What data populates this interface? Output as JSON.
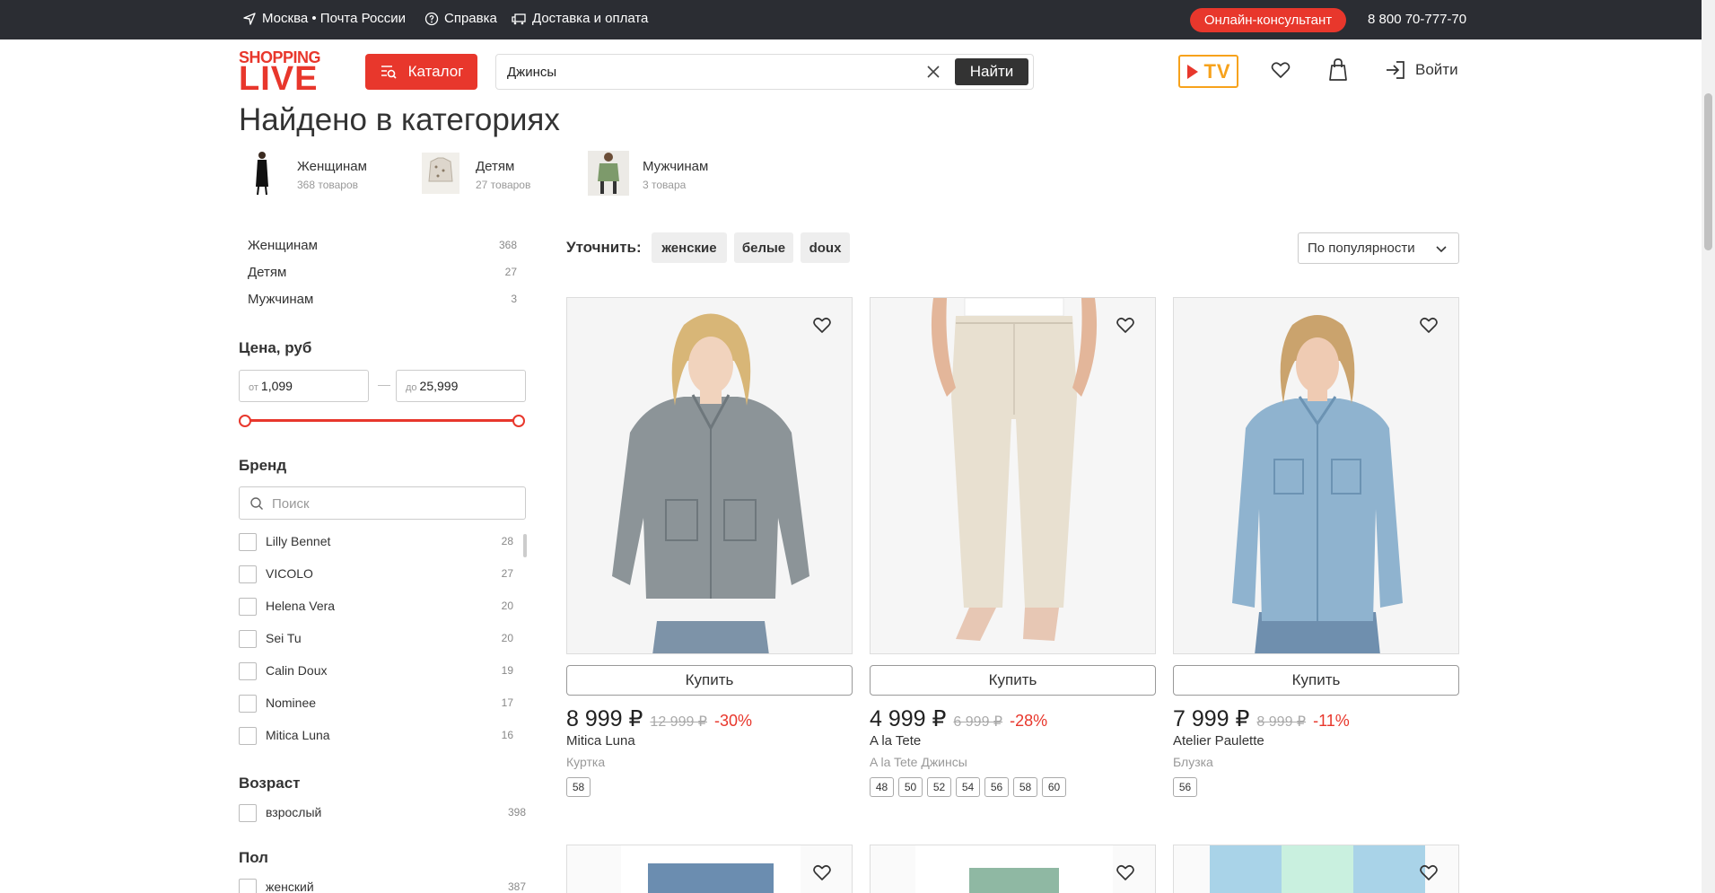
{
  "topbar": {
    "location": "Москва • Почта России",
    "help": "Справка",
    "delivery": "Доставка и оплата",
    "consultant": "Онлайн-консультант",
    "phone": "8 800 70-777-70"
  },
  "header": {
    "logo_top": "SHOPPING",
    "logo_bottom": "LIVE",
    "catalog": "Каталог",
    "search_value": "Джинсы",
    "search_button": "Найти",
    "tv": "TV",
    "login": "Войти"
  },
  "found": {
    "title": "Найдено в категориях",
    "categories": [
      {
        "name": "Женщинам",
        "count": "368 товаров"
      },
      {
        "name": "Детям",
        "count": "27 товаров"
      },
      {
        "name": "Мужчинам",
        "count": "3 товара"
      }
    ]
  },
  "sidebar": {
    "categories": [
      {
        "name": "Женщинам",
        "count": "368"
      },
      {
        "name": "Детям",
        "count": "27"
      },
      {
        "name": "Мужчинам",
        "count": "3"
      }
    ],
    "price": {
      "title": "Цена, руб",
      "from_prefix": "от",
      "from": "1,099",
      "to_prefix": "до",
      "to": "25,999",
      "dash": "—"
    },
    "brand": {
      "title": "Бренд",
      "placeholder": "Поиск",
      "items": [
        {
          "name": "Lilly Bennet",
          "count": "28"
        },
        {
          "name": "VICOLO",
          "count": "27"
        },
        {
          "name": "Helena Vera",
          "count": "20"
        },
        {
          "name": "Sei Tu",
          "count": "20"
        },
        {
          "name": "Calin Doux",
          "count": "19"
        },
        {
          "name": "Nominee",
          "count": "17"
        },
        {
          "name": "Mitica Luna",
          "count": "16"
        }
      ]
    },
    "age": {
      "title": "Возраст",
      "items": [
        {
          "name": "взрослый",
          "count": "398"
        }
      ]
    },
    "gender": {
      "title": "Пол",
      "items": [
        {
          "name": "женский",
          "count": "387"
        }
      ]
    }
  },
  "refine": {
    "label": "Уточнить:",
    "chips": [
      "женские",
      "белые",
      "doux"
    ],
    "sort": "По популярности"
  },
  "products": [
    {
      "buy": "Купить",
      "price": "8 999 ₽",
      "old_price": "12 999 ₽",
      "discount": "-30%",
      "brand": "Mitica Luna",
      "type": "Куртка",
      "sizes": [
        "58"
      ]
    },
    {
      "buy": "Купить",
      "price": "4 999 ₽",
      "old_price": "6 999 ₽",
      "discount": "-28%",
      "brand": "A la Tete",
      "type": "A la Tete Джинсы",
      "sizes": [
        "48",
        "50",
        "52",
        "54",
        "56",
        "58",
        "60"
      ]
    },
    {
      "buy": "Купить",
      "price": "7 999 ₽",
      "old_price": "8 999 ₽",
      "discount": "-11%",
      "brand": "Atelier Paulette",
      "type": "Блузка",
      "sizes": [
        "56"
      ]
    }
  ],
  "colors": {
    "accent": "#e8372c",
    "topbar": "#2b2d33",
    "tv": "#f7a21b"
  },
  "icons": {
    "location": "navigation-arrow-icon",
    "help": "question-circle-icon",
    "delivery": "truck-icon",
    "catalog": "search-list-icon",
    "clear": "close-icon",
    "favorites": "heart-icon",
    "cart": "bag-icon",
    "login": "login-arrow-icon"
  }
}
